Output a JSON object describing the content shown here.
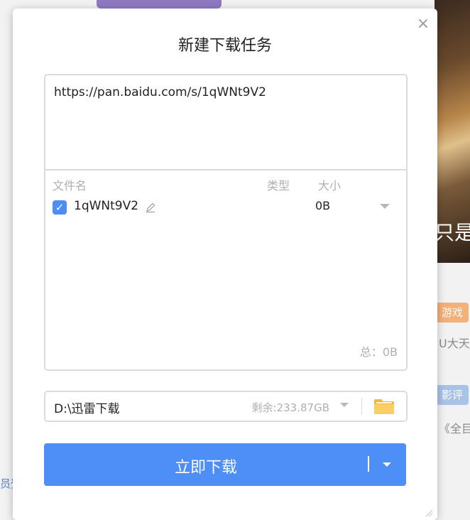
{
  "background": {
    "game_badge": "游戏",
    "review_badge": "影评",
    "line1": "U大天",
    "line2": "《全目",
    "image_text": "只是",
    "left_fragment": "员登"
  },
  "dialog": {
    "title": "新建下载任务",
    "url": "https://pan.baidu.com/s/1qWNt9V2",
    "columns": {
      "name": "文件名",
      "type": "类型",
      "size": "大小"
    },
    "files": [
      {
        "name": "1qWNt9V2",
        "size": "0B",
        "checked": true
      }
    ],
    "total": "总：0B",
    "save_path": "D:\\迅雷下载",
    "free_space": "剩余:233.87GB",
    "download_label": "立即下载",
    "icons": {
      "close": "close-icon",
      "edit": "pencil-icon",
      "folder": "folder-icon",
      "dropdown": "caret-down-icon"
    },
    "accent_color": "#4e8ef7"
  }
}
